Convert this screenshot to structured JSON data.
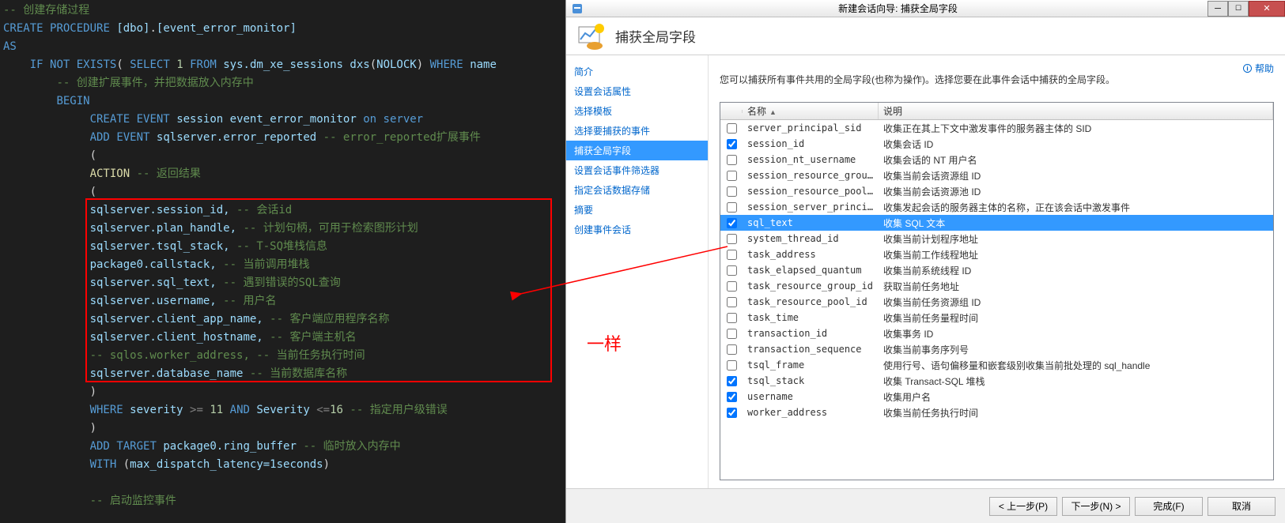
{
  "code": {
    "comment_create_sp": "-- 创建存储过程",
    "kw_create": "CREATE",
    "kw_procedure": "PROCEDURE",
    "sp_schema": "[dbo]",
    "sp_name": "[event_error_monitor]",
    "kw_as": "AS",
    "kw_if": "IF",
    "kw_not": "NOT",
    "kw_exists": "EXISTS",
    "kw_select": "SELECT",
    "num_1": "1",
    "kw_from": "FROM",
    "dmv": "sys.dm_xe_sessions",
    "alias": "dxs",
    "nolock": "NOLOCK",
    "kw_where": "WHERE",
    "col_name": "name",
    "comment_create_ext": "-- 创建扩展事件，并把数据放入内存中",
    "kw_begin": "BEGIN",
    "kw_create2": "CREATE",
    "kw_event": "EVENT",
    "kw_session": "session",
    "session_name": "event_error_monitor",
    "kw_on": "on",
    "kw_server": "server",
    "kw_add": "ADD",
    "kw_event2": "EVENT",
    "event_name": "sqlserver.error_reported",
    "comment_error_reported": "-- error_reported扩展事件",
    "kw_action_label": "ACTION",
    "comment_action": "-- 返回结果",
    "a1": "sqlserver.session_id,",
    "c1": "-- 会话id",
    "a2": "sqlserver.plan_handle,",
    "c2": "-- 计划句柄，可用于检索图形计划",
    "a3": "sqlserver.tsql_stack,",
    "c3": "-- T-SQ堆栈信息",
    "a4": "package0.callstack,",
    "c4": "-- 当前调用堆栈",
    "a5": "sqlserver.sql_text,",
    "c5": "-- 遇到错误的SQL查询",
    "a6": "sqlserver.username,",
    "c6": "-- 用户名",
    "a7": "sqlserver.client_app_name,",
    "c7": "-- 客户端应用程序名称",
    "a8": "sqlserver.client_hostname,",
    "c8": "-- 客户端主机名",
    "c9_full": "-- sqlos.worker_address, -- 当前任务执行时间",
    "a10": "sqlserver.database_name",
    "c10": "-- 当前数据库名称",
    "kw_where2": "WHERE",
    "col_sev": "severity",
    "op_ge": ">=",
    "num_11": "11",
    "kw_and": "AND",
    "col_sev2": "Severity",
    "op_le": "<=",
    "num_16": "16",
    "comment_sev": "-- 指定用户级错误",
    "kw_add2": "ADD",
    "kw_target": "TARGET",
    "target_name": "package0.ring_buffer",
    "comment_target": "-- 临时放入内存中",
    "kw_with": "WITH",
    "with_arg": "max_dispatch_latency=1seconds",
    "comment_start": "-- 启动监控事件"
  },
  "wizard": {
    "window_title": "新建会话向导: 捕获全局字段",
    "header_title": "捕获全局字段",
    "help": "帮助",
    "instruction": "您可以捕获所有事件共用的全局字段(也称为操作)。选择您要在此事件会话中捕获的全局字段。",
    "sidebar": [
      {
        "label": "简介",
        "selected": false
      },
      {
        "label": "设置会话属性",
        "selected": false
      },
      {
        "label": "选择模板",
        "selected": false
      },
      {
        "label": "选择要捕获的事件",
        "selected": false
      },
      {
        "label": "捕获全局字段",
        "selected": true
      },
      {
        "label": "设置会话事件筛选器",
        "selected": false
      },
      {
        "label": "指定会话数据存储",
        "selected": false
      },
      {
        "label": "摘要",
        "selected": false
      },
      {
        "label": "创建事件会话",
        "selected": false
      }
    ],
    "columns": {
      "name": "名称",
      "desc": "说明"
    },
    "rows": [
      {
        "checked": false,
        "name": "server_principal_sid",
        "desc": "收集正在其上下文中激发事件的服务器主体的 SID",
        "selected": false
      },
      {
        "checked": true,
        "name": "session_id",
        "desc": "收集会话 ID",
        "selected": false
      },
      {
        "checked": false,
        "name": "session_nt_username",
        "desc": "收集会话的 NT 用户名",
        "selected": false
      },
      {
        "checked": false,
        "name": "session_resource_grou...",
        "desc": "收集当前会话资源组 ID",
        "selected": false
      },
      {
        "checked": false,
        "name": "session_resource_pool_id",
        "desc": "收集当前会话资源池 ID",
        "selected": false
      },
      {
        "checked": false,
        "name": "session_server_princi...",
        "desc": "收集发起会话的服务器主体的名称，正在该会话中激发事件",
        "selected": false
      },
      {
        "checked": true,
        "name": "sql_text",
        "desc": "收集 SQL 文本",
        "selected": true
      },
      {
        "checked": false,
        "name": "system_thread_id",
        "desc": "收集当前计划程序地址",
        "selected": false
      },
      {
        "checked": false,
        "name": "task_address",
        "desc": "收集当前工作线程地址",
        "selected": false
      },
      {
        "checked": false,
        "name": "task_elapsed_quantum",
        "desc": "收集当前系统线程 ID",
        "selected": false
      },
      {
        "checked": false,
        "name": "task_resource_group_id",
        "desc": "获取当前任务地址",
        "selected": false
      },
      {
        "checked": false,
        "name": "task_resource_pool_id",
        "desc": "收集当前任务资源组 ID",
        "selected": false
      },
      {
        "checked": false,
        "name": "task_time",
        "desc": "收集当前任务量程时间",
        "selected": false
      },
      {
        "checked": false,
        "name": "transaction_id",
        "desc": "收集事务 ID",
        "selected": false
      },
      {
        "checked": false,
        "name": "transaction_sequence",
        "desc": "收集当前事务序列号",
        "selected": false
      },
      {
        "checked": false,
        "name": "tsql_frame",
        "desc": "使用行号、语句偏移量和嵌套级别收集当前批处理的 sql_handle",
        "selected": false
      },
      {
        "checked": true,
        "name": "tsql_stack",
        "desc": "收集 Transact-SQL 堆栈",
        "selected": false
      },
      {
        "checked": true,
        "name": "username",
        "desc": "收集用户名",
        "selected": false
      },
      {
        "checked": true,
        "name": "worker_address",
        "desc": "收集当前任务执行时间",
        "selected": false
      }
    ],
    "buttons": {
      "prev": "< 上一步(P)",
      "next": "下一步(N) >",
      "finish": "完成(F)",
      "cancel": "取消"
    }
  },
  "annotation": {
    "label": "一样"
  }
}
